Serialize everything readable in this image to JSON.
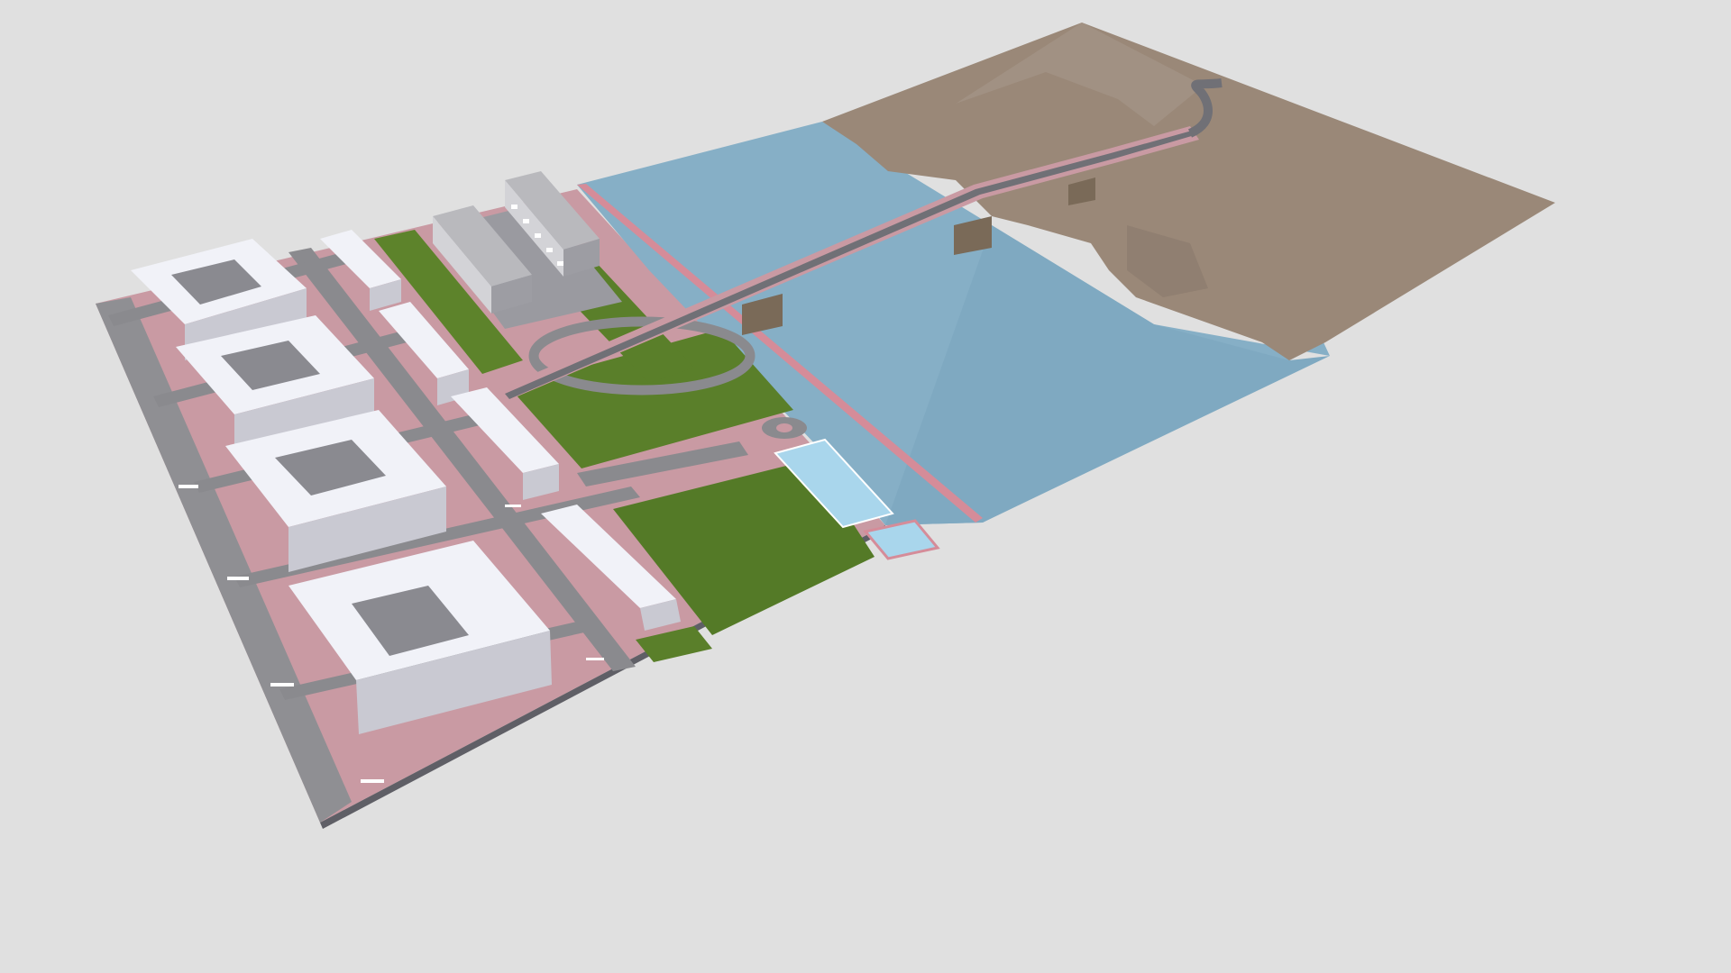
{
  "scene": {
    "description_visible_text": "",
    "colors": {
      "background": "#e0e0e0",
      "water": "#86afc6",
      "terrain": "#9a8878",
      "grass": "#5a7f2a",
      "grass_light": "#6b8f34",
      "road": "#8a8a8e",
      "sidewalk": "#c99aa3",
      "building_white": "#f1f2f8",
      "building_side": "#c9c9d2",
      "building_grey": "#b7b7bb",
      "court": "#a9d6ec",
      "bridge_support": "#7a6a58"
    }
  }
}
